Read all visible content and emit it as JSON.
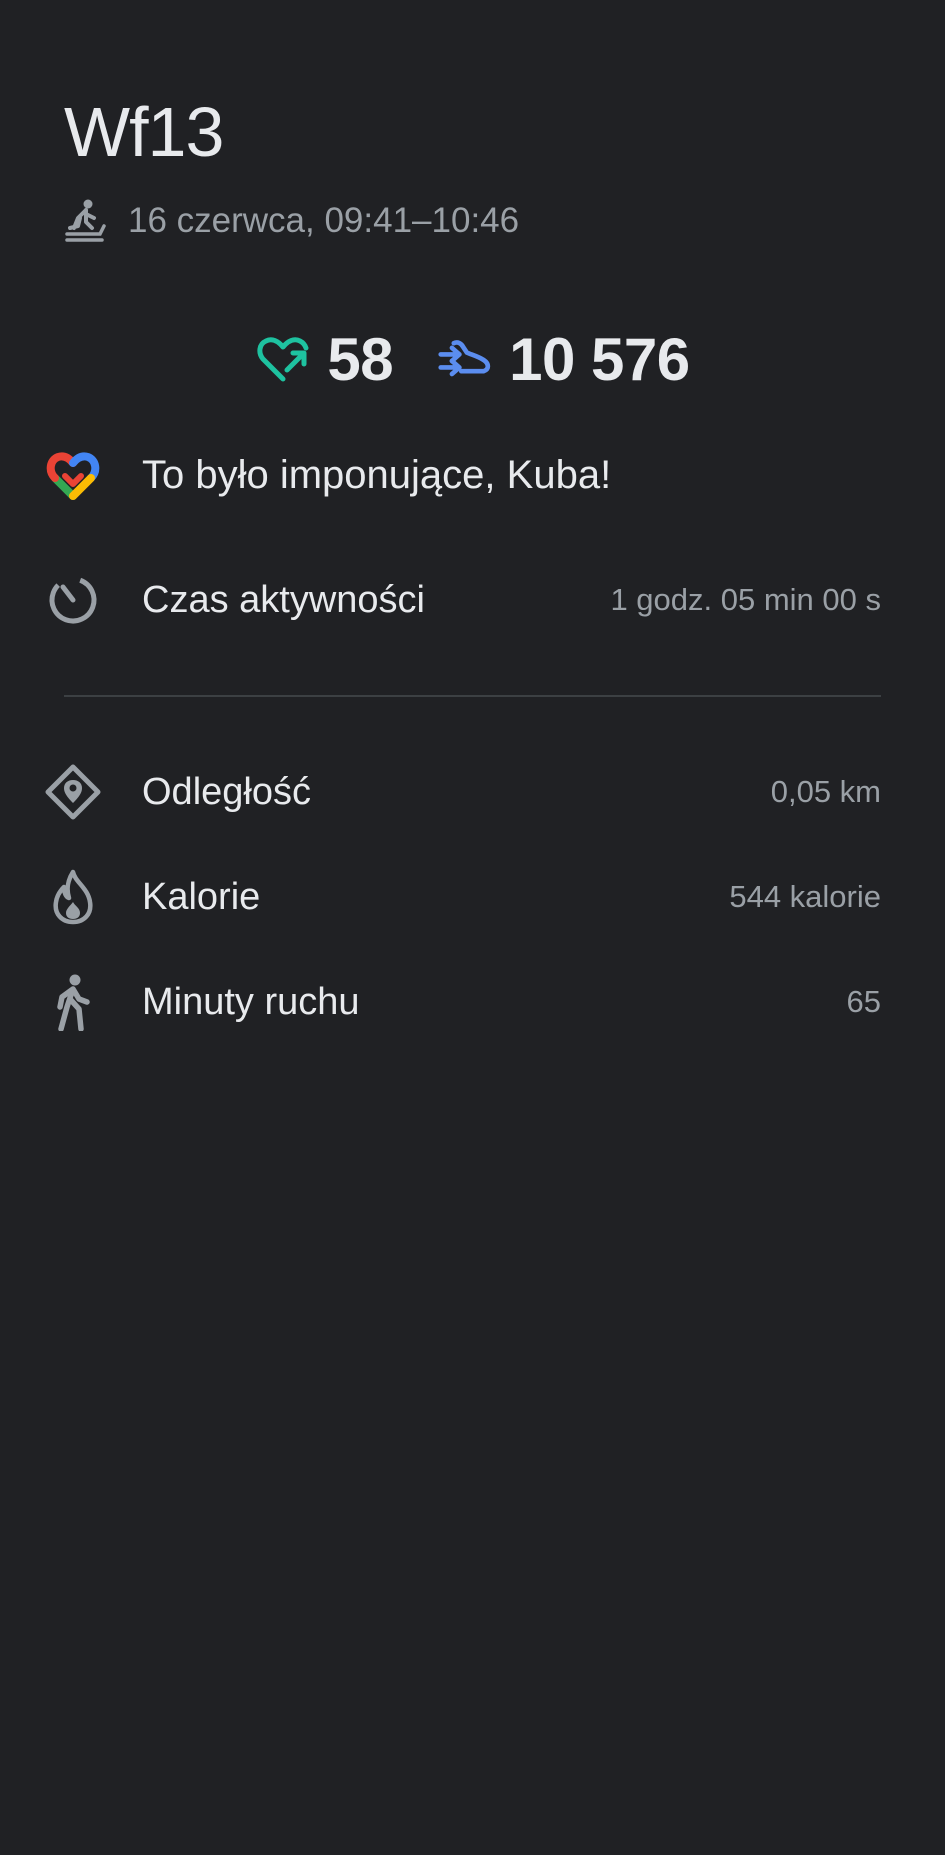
{
  "activity": {
    "title": "Wf13",
    "datetime": "16 czerwca, 09:41–10:46",
    "type_icon": "treadmill-walk-icon"
  },
  "stats": {
    "heart_points": "58",
    "steps": "10 576",
    "heart_color": "#1ec2a0",
    "steps_color": "#5b8def"
  },
  "motivation": {
    "text": "To było imponujące, Kuba!",
    "icon": "google-fit-heart-icon"
  },
  "active_time": {
    "label": "Czas aktywności",
    "value": "1 godz. 05 min 00 s",
    "icon": "timer-icon"
  },
  "metrics": [
    {
      "label": "Odległość",
      "value": "0,05 km",
      "icon": "location-diamond-icon"
    },
    {
      "label": "Kalorie",
      "value": "544 kalorie",
      "icon": "flame-icon"
    },
    {
      "label": "Minuty ruchu",
      "value": "65",
      "icon": "walking-person-icon"
    }
  ]
}
